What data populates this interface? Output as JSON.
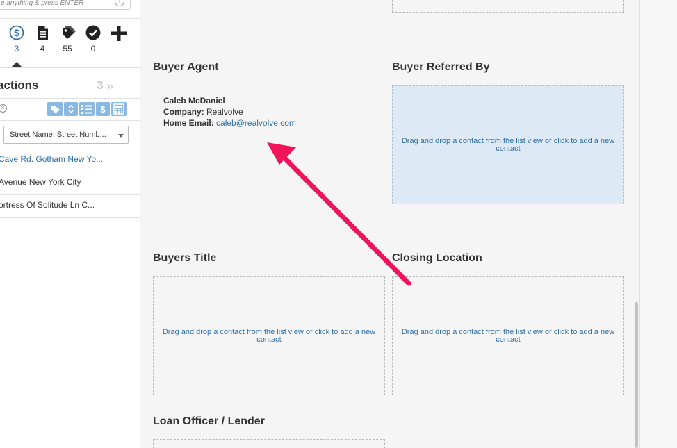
{
  "sidebar": {
    "search_placeholder": "e anything & press ENTER",
    "info_glyph": "i",
    "icons": [
      {
        "name": "dollar-icon",
        "count": "3",
        "active": true
      },
      {
        "name": "document-icon",
        "count": "4"
      },
      {
        "name": "tags-icon",
        "count": "55"
      },
      {
        "name": "check-icon",
        "count": "0"
      },
      {
        "name": "plus-icon",
        "count": ""
      }
    ],
    "section_title": "actions",
    "section_count": "3",
    "chevron": "»",
    "clear_glyph": "×",
    "sort_value": "Street Name, Street Numb...",
    "transactions": [
      "Cave Rd. Gotham New Yo...",
      " Avenue New York City",
      "ortress Of Solitude Ln C..."
    ]
  },
  "main": {
    "buyer_agent": {
      "title": "Buyer Agent",
      "name": "Caleb McDaniel",
      "company_label": "Company:",
      "company": "Realvolve",
      "email_label": "Home Email:",
      "email": "caleb@realvolve.com"
    },
    "buyer_referred_by": {
      "title": "Buyer Referred By",
      "placeholder": "Drag and drop a contact from the list view or click to add a new contact"
    },
    "buyers_title": {
      "title": "Buyers Title",
      "placeholder": "Drag and drop a contact from the list view or click to add a new contact"
    },
    "closing_location": {
      "title": "Closing Location",
      "placeholder": "Drag and drop a contact from the list view or click to add a new contact"
    },
    "loan_officer": {
      "title": "Loan Officer / Lender"
    }
  },
  "colors": {
    "accent": "#2d6ea8",
    "highlight": "#dde9f4",
    "annotation_arrow": "#f0145a"
  }
}
